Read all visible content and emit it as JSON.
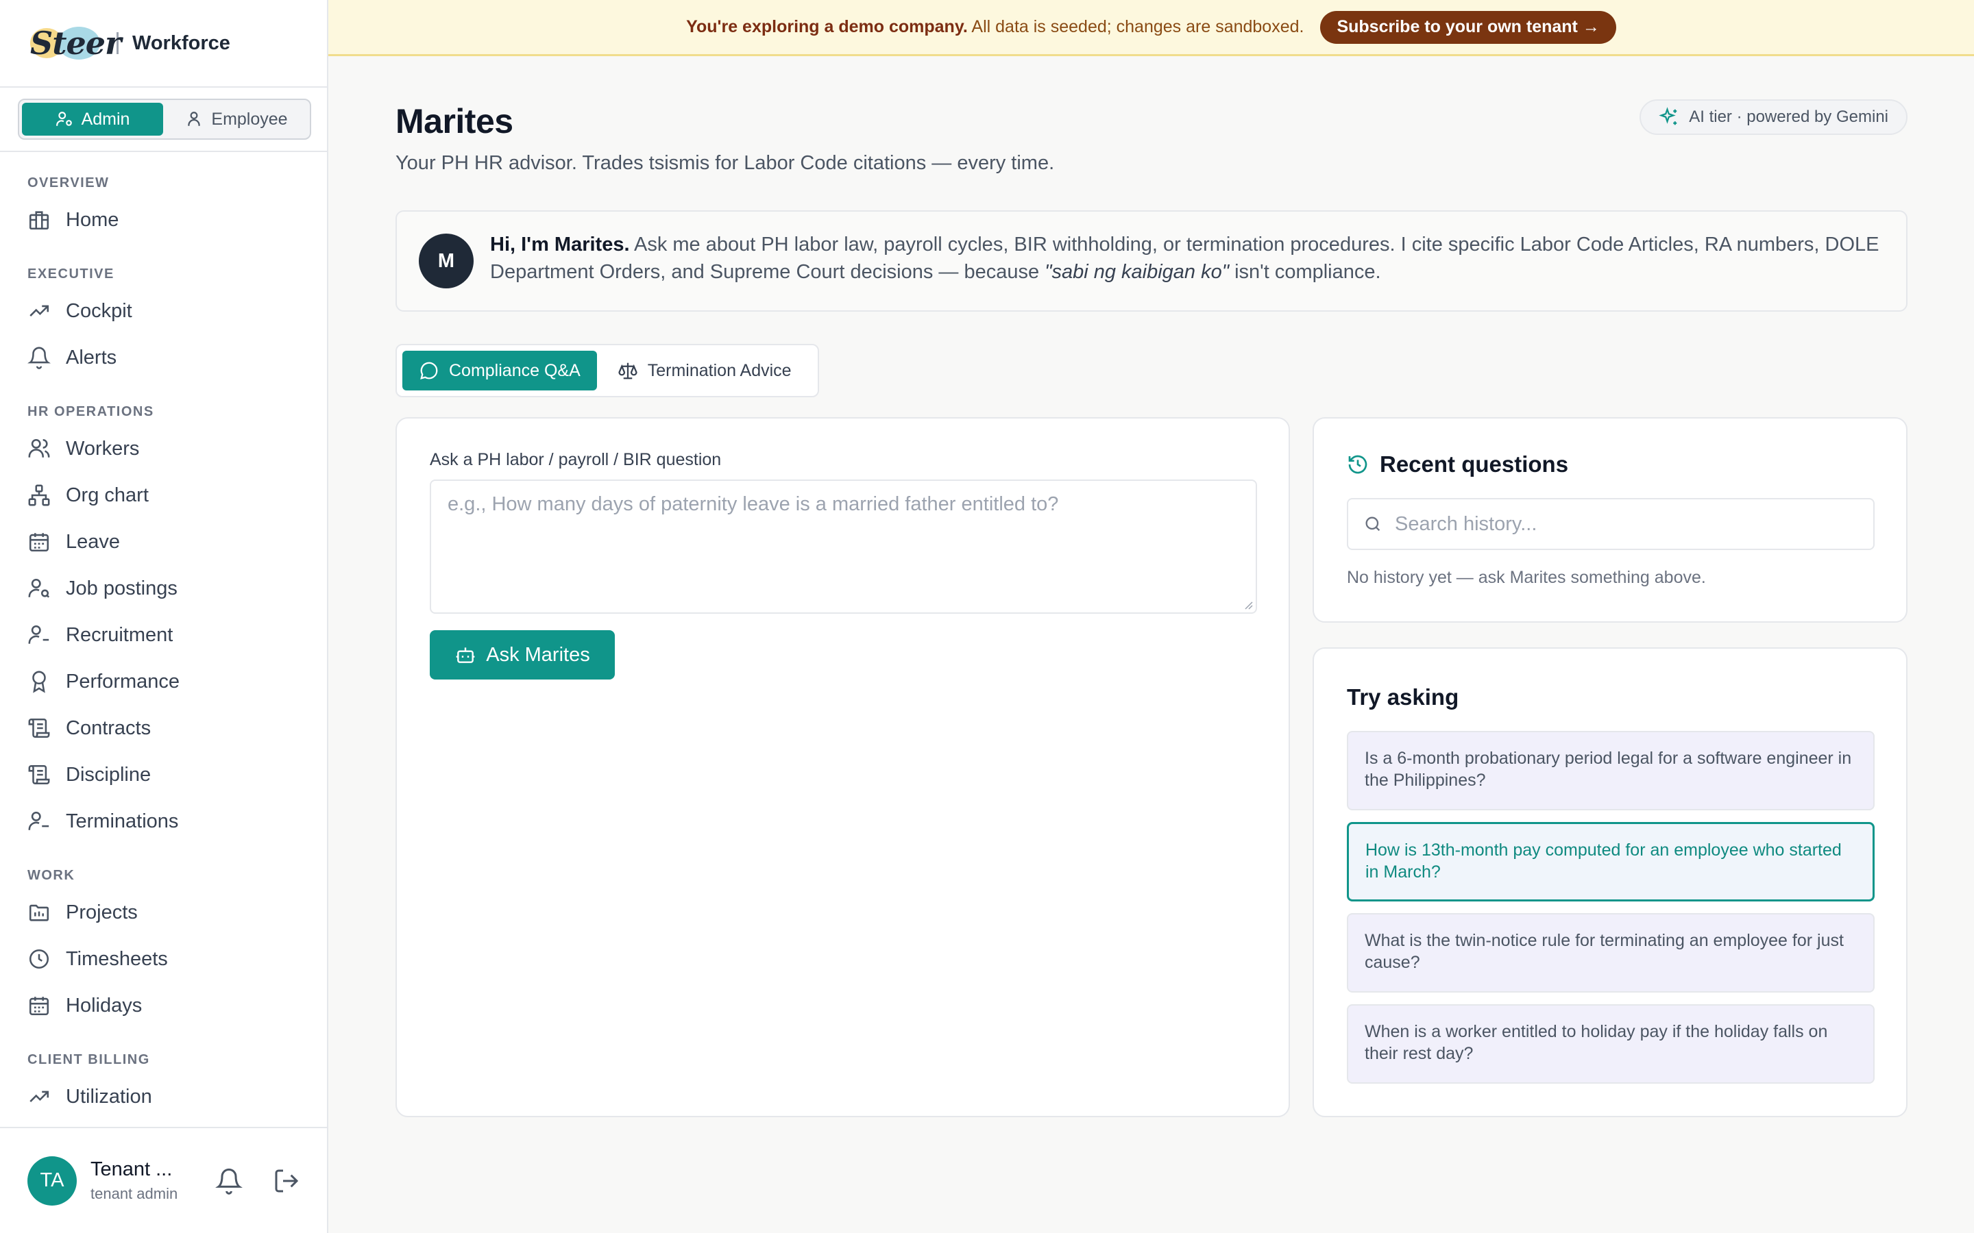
{
  "brand": {
    "logo": "Steer",
    "product": "Workforce"
  },
  "role_toggle": {
    "admin": "Admin",
    "employee": "Employee"
  },
  "nav": {
    "overview": {
      "label": "OVERVIEW",
      "items": [
        {
          "label": "Home",
          "icon": "home-icon"
        }
      ]
    },
    "executive": {
      "label": "EXECUTIVE",
      "items": [
        {
          "label": "Cockpit",
          "icon": "trending-up-icon"
        },
        {
          "label": "Alerts",
          "icon": "bell-icon"
        }
      ]
    },
    "hr_operations": {
      "label": "HR OPERATIONS",
      "items": [
        {
          "label": "Workers",
          "icon": "users-icon"
        },
        {
          "label": "Org chart",
          "icon": "org-chart-icon"
        },
        {
          "label": "Leave",
          "icon": "calendar-icon"
        },
        {
          "label": "Job postings",
          "icon": "user-search-icon"
        },
        {
          "label": "Recruitment",
          "icon": "user-plus-icon"
        },
        {
          "label": "Performance",
          "icon": "award-icon"
        },
        {
          "label": "Contracts",
          "icon": "scroll-icon"
        },
        {
          "label": "Discipline",
          "icon": "scroll-icon"
        },
        {
          "label": "Terminations",
          "icon": "user-minus-icon"
        }
      ]
    },
    "work": {
      "label": "WORK",
      "items": [
        {
          "label": "Projects",
          "icon": "folder-icon"
        },
        {
          "label": "Timesheets",
          "icon": "clock-icon"
        },
        {
          "label": "Holidays",
          "icon": "calendar-icon"
        }
      ]
    },
    "client_billing": {
      "label": "CLIENT BILLING",
      "items": [
        {
          "label": "Utilization",
          "icon": "trending-up-icon"
        }
      ]
    }
  },
  "user": {
    "initials": "TA",
    "name": "Tenant ...",
    "role": "tenant admin"
  },
  "banner": {
    "bold": "You're exploring a demo company.",
    "text": "All data is seeded; changes are sandboxed.",
    "button": "Subscribe to your own tenant →"
  },
  "page": {
    "title": "Marites",
    "subtitle": "Your PH HR advisor. Trades tsismis for Labor Code citations — every time.",
    "ai_pill": "AI tier · powered by Gemini"
  },
  "intro": {
    "initial": "M",
    "bold": "Hi, I'm Marites.",
    "text_1": " Ask me about PH labor law, payroll cycles, BIR withholding, or termination procedures. I cite specific Labor Code Articles, RA numbers, DOLE Department Orders, and Supreme Court decisions — because ",
    "italic": "\"sabi ng kaibigan ko\"",
    "text_2": " isn't compliance."
  },
  "tabs": {
    "compliance": "Compliance Q&A",
    "termination": "Termination Advice"
  },
  "ask": {
    "label": "Ask a PH labor / payroll / BIR question",
    "placeholder": "e.g., How many days of paternity leave is a married father entitled to?",
    "button": "Ask Marites"
  },
  "recent": {
    "title": "Recent questions",
    "search_placeholder": "Search history...",
    "empty": "No history yet — ask Marites something above."
  },
  "try_asking": {
    "title": "Try asking",
    "suggestions": [
      "Is a 6-month probationary period legal for a software engineer in the Philippines?",
      "How is 13th-month pay computed for an employee who started in March?",
      "What is the twin-notice rule for terminating an employee for just cause?",
      "When is a worker entitled to holiday pay if the holiday falls on their rest day?"
    ]
  },
  "colors": {
    "accent": "#10958a",
    "banner_bg": "#fdf8de",
    "banner_button": "#7a3510"
  }
}
